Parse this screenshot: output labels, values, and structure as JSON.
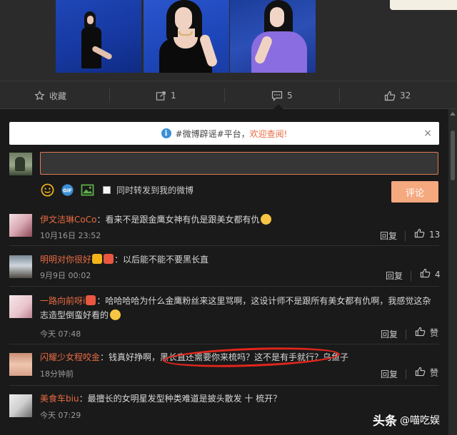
{
  "post_actions": {
    "favorite": {
      "label": "收藏",
      "icon": "star-icon"
    },
    "repost": {
      "count": "1",
      "icon": "share-icon"
    },
    "comment": {
      "count": "5",
      "icon": "comment-icon"
    },
    "like": {
      "count": "32",
      "icon": "thumbs-up-icon"
    }
  },
  "notice": {
    "prefix": "#微博辟谣#平台，",
    "link": "欢迎查阅!",
    "close": "×"
  },
  "composer": {
    "forward_label": "同时转发到我的微博",
    "submit_label": "评论"
  },
  "comments": [
    {
      "user": "伊文洁琳CoCo",
      "text": "：看来不是跟金鹰女神有仇是跟美女都有仇",
      "time": "10月16日 23:52",
      "reply": "回复",
      "likes": "13"
    },
    {
      "user": "明明对你很好",
      "text": "：以后能不能不要黑长直",
      "time": "9月9日 00:02",
      "reply": "回复",
      "likes": "4"
    },
    {
      "user": "一路向前呀i",
      "text": "：哈哈哈哈为什么金鹰粉丝来这里骂啊，这设计师不是跟所有美女都有仇啊，我感觉这杂志造型倒蛮好看的",
      "time": "今天 07:48",
      "reply": "回复",
      "likes": "赞"
    },
    {
      "user": "闪耀少女程咬金",
      "text": "：钱真好挣啊，黑长直还需要你来梳吗？这不是有手就行？乌鱼子",
      "time": "18分钟前",
      "reply": "回复",
      "likes": "赞"
    },
    {
      "user": "美食车biu",
      "text": "：最擅长的女明星发型种类难道是披头散发 十 梳开？",
      "time": "今天 07:29",
      "reply": "回复",
      "likes": "赞"
    }
  ],
  "watermark": {
    "brand": "头条",
    "account": "@喵吃娱"
  },
  "colors": {
    "accent": "#e76b43",
    "submit": "#f5a97f",
    "panel": "#1a1a1a",
    "highlight_circle": "#e3261c"
  }
}
